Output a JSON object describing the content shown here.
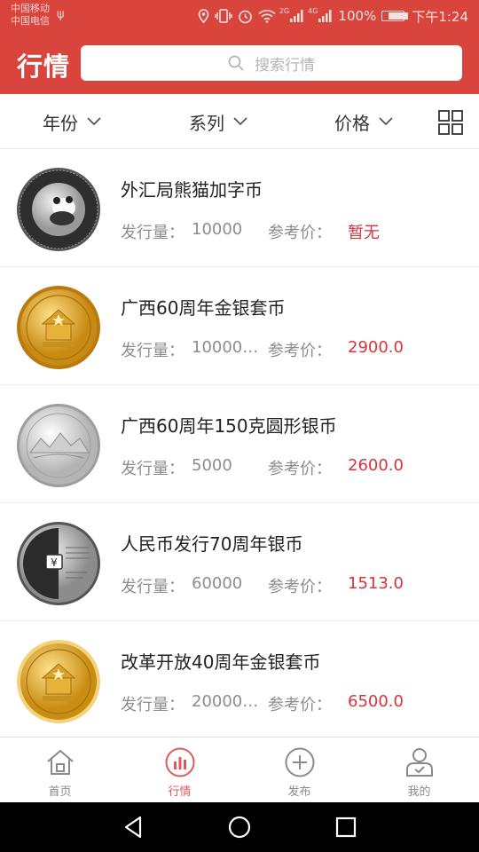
{
  "status_bar": {
    "carrier_1": "中国移动",
    "carrier_2": "中国电信",
    "battery_percent": "100%",
    "battery_level": 1.0,
    "time": "下午1:24",
    "signal_1_tag": "2G",
    "signal_2_tag": "4G"
  },
  "header": {
    "title": "行情",
    "search_placeholder": "搜索行情"
  },
  "filters": {
    "year": "年份",
    "series": "系列",
    "price": "价格"
  },
  "list": {
    "issue_label": "发行量：",
    "price_label": "参考价：",
    "items": [
      {
        "name": "外汇局熊猫加字币",
        "issue": "10000",
        "price": "暂无",
        "coin": "silver-panda-coin"
      },
      {
        "name": "广西60周年金银套币",
        "issue": "10000,…",
        "price": "2900.0",
        "coin": "gold-emblem-coin"
      },
      {
        "name": "广西60周年150克圆形银币",
        "issue": "5000",
        "price": "2600.0",
        "coin": "silver-landscape-coin"
      },
      {
        "name": "人民币发行70周年银币",
        "issue": "60000",
        "price": "1513.0",
        "coin": "silver-rmb-coin"
      },
      {
        "name": "改革开放40周年金银套币",
        "issue": "20000;…",
        "price": "6500.0",
        "coin": "gold-emblem-coin"
      }
    ]
  },
  "bottom_nav": {
    "home": "首页",
    "market": "行情",
    "publish": "发布",
    "mine": "我的"
  },
  "colors": {
    "brand": "#d9453d",
    "price": "#d9333a",
    "active_tab": "#e05a55"
  }
}
